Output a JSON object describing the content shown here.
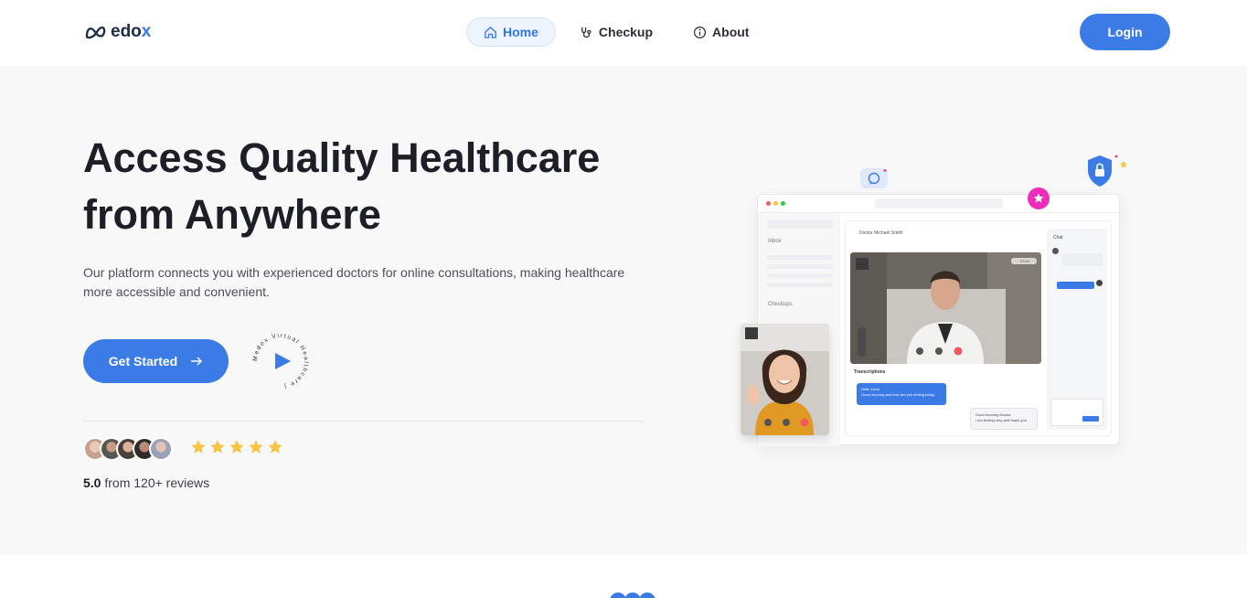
{
  "brand": {
    "name_initial": "M",
    "name_rest": "edo",
    "name_x": "x"
  },
  "nav": {
    "links": [
      {
        "label": "Home",
        "icon": "home-icon",
        "active": true
      },
      {
        "label": "Checkup",
        "icon": "stethoscope-icon",
        "active": false
      },
      {
        "label": "About",
        "icon": "info-icon",
        "active": false
      }
    ],
    "login_label": "Login"
  },
  "hero": {
    "title_line1": "Access Quality Healthcare",
    "title_line2": "from Anywhere",
    "description": "Our platform connects you with experienced doctors for online consultations, making healthcare more accessible and convenient.",
    "cta_label": "Get Started",
    "play_ring_text": "Medox Virtual Healthcare | ",
    "rating_score": "5.0",
    "rating_text": " from 120+ reviews",
    "stars": 5
  },
  "mockup": {
    "sidebar_inbox": "Inbox",
    "sidebar_checkups": "Checkups",
    "doctor_name": "Doctor Michael Smith",
    "call_time": "23:04",
    "transcriptions_label": "Transcriptions",
    "bubble_in_1": "Hello John!",
    "bubble_in_2": "Good morning and how are you feeling today.",
    "bubble_out_1": "Good morning Doctor.",
    "bubble_out_2": "I am feeling very well thank you.",
    "chat_label": "Chat"
  },
  "colors": {
    "accent": "#3a7be6",
    "hero_bg": "#f8f8f9",
    "star": "#f6c544",
    "pink": "#f02db9"
  }
}
